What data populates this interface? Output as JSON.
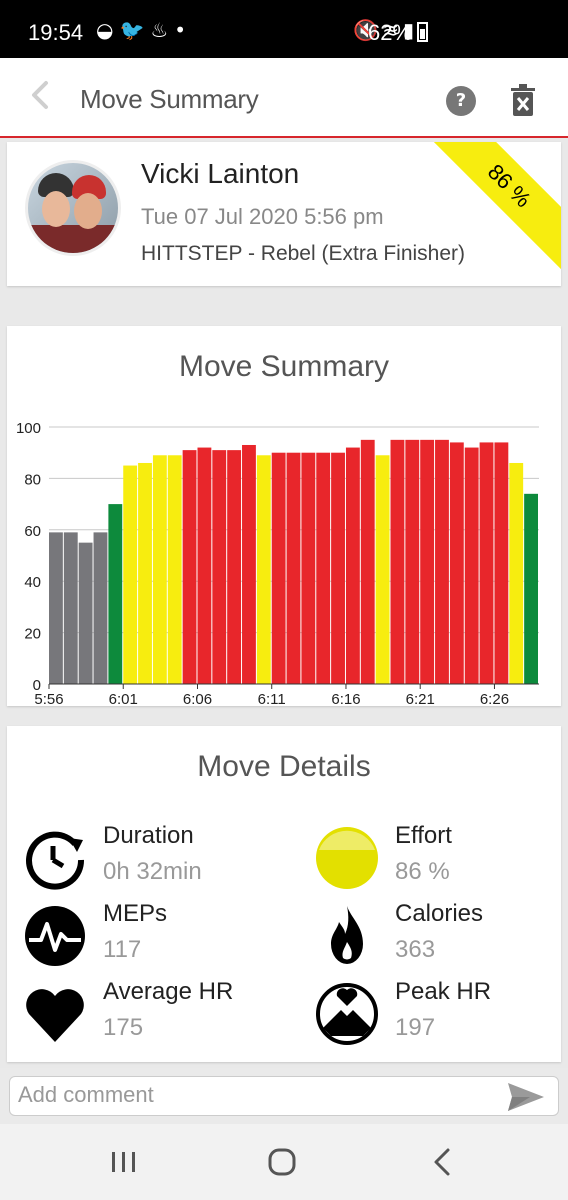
{
  "status_bar": {
    "time": "19:54",
    "battery": "62%",
    "icons_left": [
      "activity-icon",
      "twitter-icon",
      "notification-icon",
      "dot"
    ],
    "icons_right": [
      "mute-icon",
      "wifi-icon",
      "volte-icon",
      "signal-icon"
    ]
  },
  "app_bar": {
    "title": "Move Summary"
  },
  "profile": {
    "name": "Vicki Lainton",
    "date": "Tue 07 Jul 2020 5:56 pm",
    "workout": "HITTSTEP - Rebel (Extra Finisher)",
    "effort_badge": "86 %"
  },
  "chart_section": {
    "title": "Move Summary"
  },
  "chart_data": {
    "type": "bar",
    "title": "Move Summary",
    "xlabel": "",
    "ylabel": "",
    "ylim": [
      0,
      100
    ],
    "yticks": [
      "0",
      "20",
      "40",
      "60",
      "80",
      "100"
    ],
    "xtick_labels": [
      "5:56",
      "6:01",
      "6:06",
      "6:11",
      "6:16",
      "6:21",
      "6:26"
    ],
    "grid": true,
    "zone_colors": {
      "grey": "#77777b",
      "green": "#0d8a3c",
      "yellow": "#f7ed0f",
      "red": "#e8262b"
    },
    "values": [
      59,
      59,
      55,
      59,
      70,
      85,
      86,
      89,
      89,
      91,
      92,
      91,
      91,
      93,
      89,
      90,
      90,
      90,
      90,
      90,
      92,
      95,
      89,
      95,
      95,
      95,
      95,
      94,
      92,
      94,
      94,
      86,
      74
    ],
    "zones": [
      "grey",
      "grey",
      "grey",
      "grey",
      "green",
      "yellow",
      "yellow",
      "yellow",
      "yellow",
      "red",
      "red",
      "red",
      "red",
      "red",
      "yellow",
      "red",
      "red",
      "red",
      "red",
      "red",
      "red",
      "red",
      "yellow",
      "red",
      "red",
      "red",
      "red",
      "red",
      "red",
      "red",
      "red",
      "yellow",
      "green"
    ]
  },
  "details": {
    "title": "Move Details",
    "items": [
      {
        "label": "Duration",
        "value": "0h 32min",
        "icon": "duration-clock-icon"
      },
      {
        "label": "Effort",
        "value": "86 %",
        "icon": "effort-circle-icon"
      },
      {
        "label": "MEPs",
        "value": "117",
        "icon": "meps-pulse-icon"
      },
      {
        "label": "Calories",
        "value": "363",
        "icon": "flame-icon"
      },
      {
        "label": "Average HR",
        "value": "175",
        "icon": "heart-icon"
      },
      {
        "label": "Peak HR",
        "value": "197",
        "icon": "peak-heart-icon"
      }
    ]
  },
  "comment": {
    "placeholder": "Add comment"
  }
}
